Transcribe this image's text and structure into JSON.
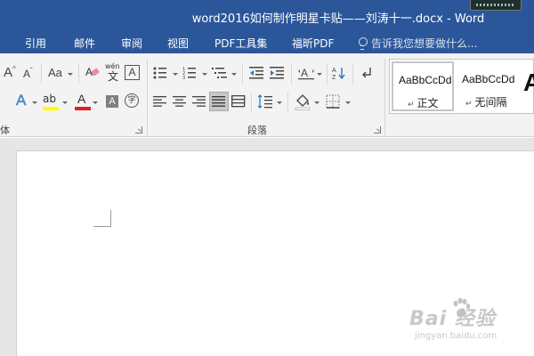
{
  "window": {
    "title": "word2016如何制作明星卡贴——刘涛十一.docx - Word"
  },
  "tabs": [
    {
      "label": "引用"
    },
    {
      "label": "邮件"
    },
    {
      "label": "审阅"
    },
    {
      "label": "视图"
    },
    {
      "label": "PDF工具集"
    },
    {
      "label": "福昕PDF"
    }
  ],
  "tell_me": {
    "placeholder": "告诉我您想要做什么..."
  },
  "ribbon": {
    "font": {
      "label": "体",
      "grow_font": "A",
      "shrink_font": "A",
      "change_case": "Aa",
      "phonetic": "wén",
      "phonetic_char": "文",
      "char_border": "A",
      "text_effects": "A",
      "highlight": "ab",
      "font_color": "A",
      "char_shading": "A",
      "enclose": "字"
    },
    "paragraph": {
      "label": "段落"
    },
    "styles": {
      "items": [
        {
          "sample": "AaBbCcDd",
          "name": "正文",
          "active": true
        },
        {
          "sample": "AaBbCcDd",
          "name": "无间隔",
          "active": false
        }
      ],
      "next_sample": "A"
    }
  },
  "watermark": {
    "text": "Bai  经验",
    "url": "jingyan.baidu.com"
  },
  "colors": {
    "title_bar": "#2b579a",
    "ribbon_bg": "#f3f3f3",
    "document_bg": "#e6e6e6",
    "highlight_yellow": "#ffff00",
    "font_red": "#e02020"
  }
}
